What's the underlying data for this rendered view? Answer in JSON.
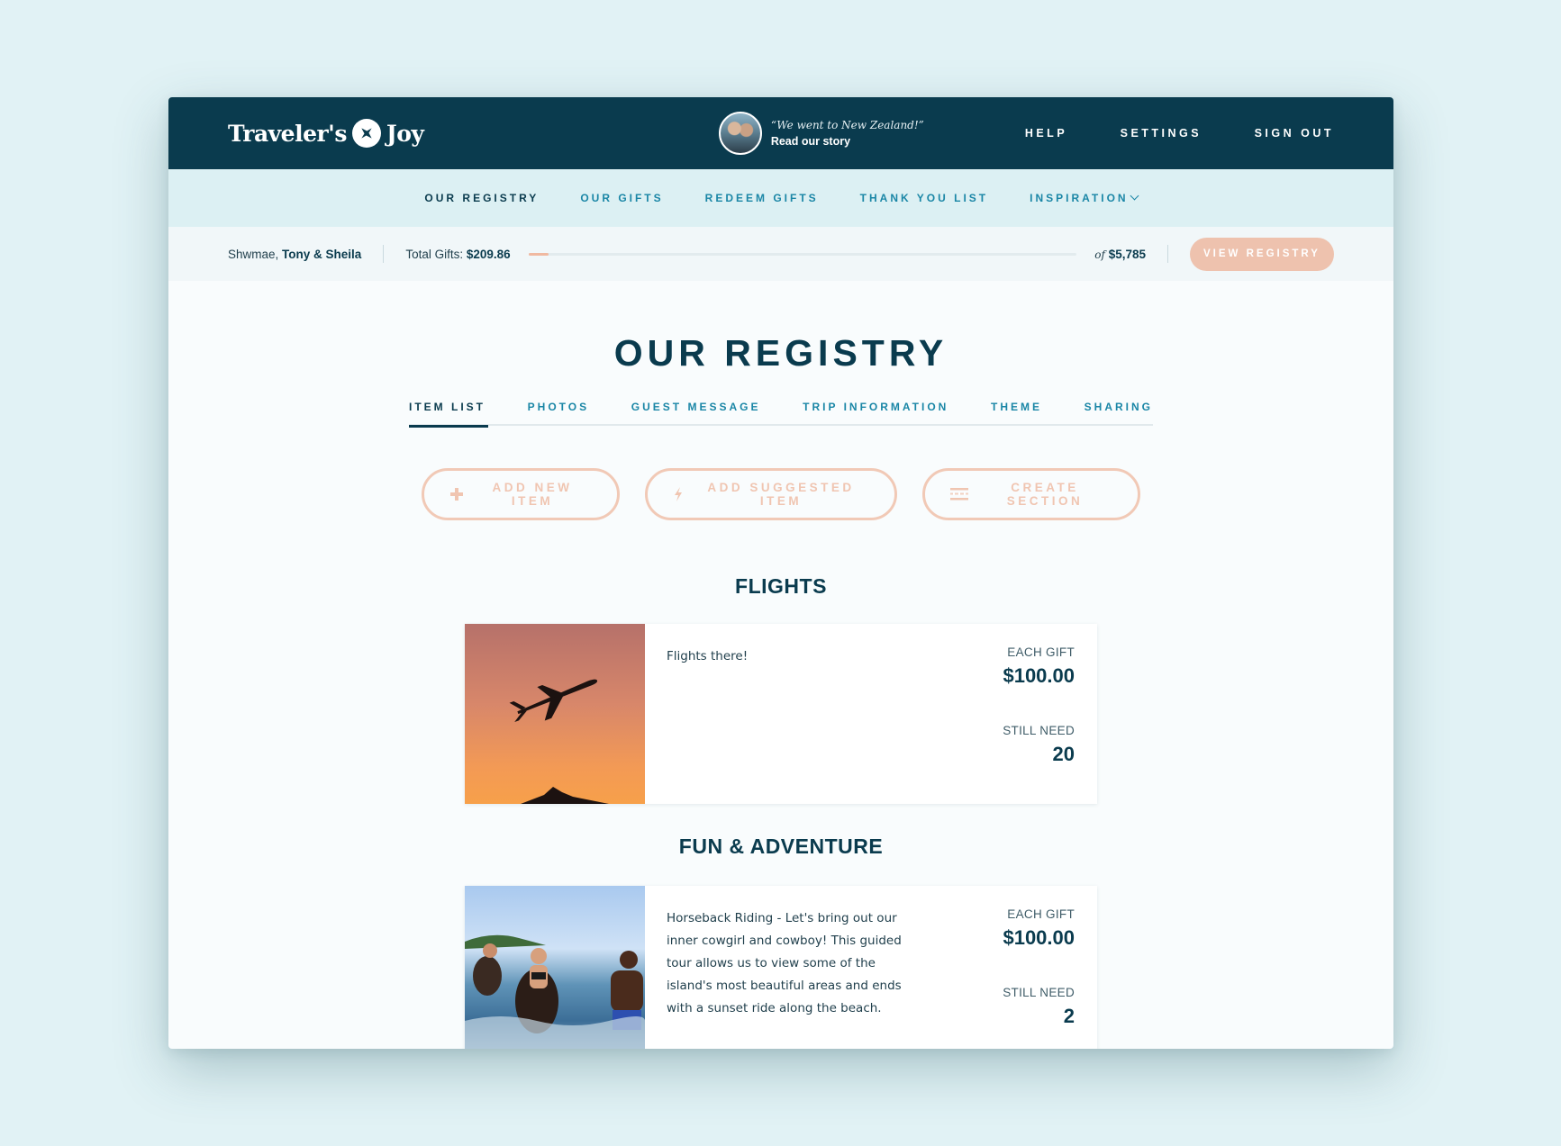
{
  "header": {
    "logo_left": "Traveler's",
    "logo_right": "Joy",
    "story_quote": "“We went to New Zealand!”",
    "story_link": "Read our story",
    "nav": [
      "HELP",
      "SETTINGS",
      "SIGN OUT"
    ]
  },
  "subnav": {
    "items": [
      "OUR REGISTRY",
      "OUR GIFTS",
      "REDEEM GIFTS",
      "THANK YOU LIST",
      "INSPIRATION"
    ],
    "active": "OUR REGISTRY"
  },
  "status": {
    "greeting": "Shwmae,",
    "names": "Tony & Sheila",
    "total_label": "Total Gifts:",
    "total_value": "$209.86",
    "goal_prefix": "of",
    "goal_value": "$5,785",
    "progress_fraction": 0.036,
    "view_button": "VIEW REGISTRY"
  },
  "page": {
    "title": "OUR REGISTRY",
    "tabs": [
      "ITEM LIST",
      "PHOTOS",
      "GUEST MESSAGE",
      "TRIP INFORMATION",
      "THEME",
      "SHARING"
    ],
    "active_tab": "ITEM LIST"
  },
  "actions": {
    "add_new": "ADD NEW ITEM",
    "add_suggested": "ADD SUGGESTED ITEM",
    "create_section": "CREATE SECTION"
  },
  "sections": [
    {
      "title": "FLIGHTS",
      "item": {
        "description": "Flights there!",
        "each_gift_label": "EACH GIFT",
        "each_gift_value": "$100.00",
        "still_need_label": "STILL NEED",
        "still_need_value": "20"
      }
    },
    {
      "title": "FUN & ADVENTURE",
      "item": {
        "description": "Horseback Riding - Let's bring out our inner cowgirl and cowboy! This guided tour allows us to view some of the island's most beautiful areas and ends with a sunset ride along the beach.",
        "each_gift_label": "EACH GIFT",
        "each_gift_value": "$100.00",
        "still_need_label": "STILL NEED",
        "still_need_value": "2"
      }
    }
  ],
  "colors": {
    "navy": "#0a3b4e",
    "teal_link": "#1a86a6",
    "peach": "#eec2ae",
    "background": "#e1f2f5"
  },
  "icons": [
    "plane-globe-icon",
    "plus-icon",
    "lightning-icon",
    "section-lines-icon",
    "chevron-down-icon"
  ]
}
